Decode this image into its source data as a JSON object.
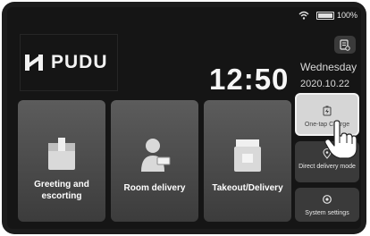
{
  "status": {
    "battery": "100%"
  },
  "brand": {
    "name": "PUDU"
  },
  "clock": {
    "time": "12:50",
    "weekday": "Wednesday",
    "date": "2020.10.22"
  },
  "modes": [
    {
      "label": "Greeting and escorting",
      "icon": "box-icon"
    },
    {
      "label": "Room delivery",
      "icon": "person-delivery-icon"
    },
    {
      "label": "Takeout/Delivery",
      "icon": "takeout-bag-icon"
    }
  ],
  "side_actions": [
    {
      "label": "One-tap Charge",
      "icon": "battery-charge-icon",
      "active": true
    },
    {
      "label": "Direct delivery mode",
      "icon": "location-pin-icon"
    },
    {
      "label": "System settings",
      "icon": "settings-icon"
    }
  ],
  "colors": {
    "background": "#151515",
    "card": "#4a4a4a",
    "active_button": "#d6d6d6"
  }
}
